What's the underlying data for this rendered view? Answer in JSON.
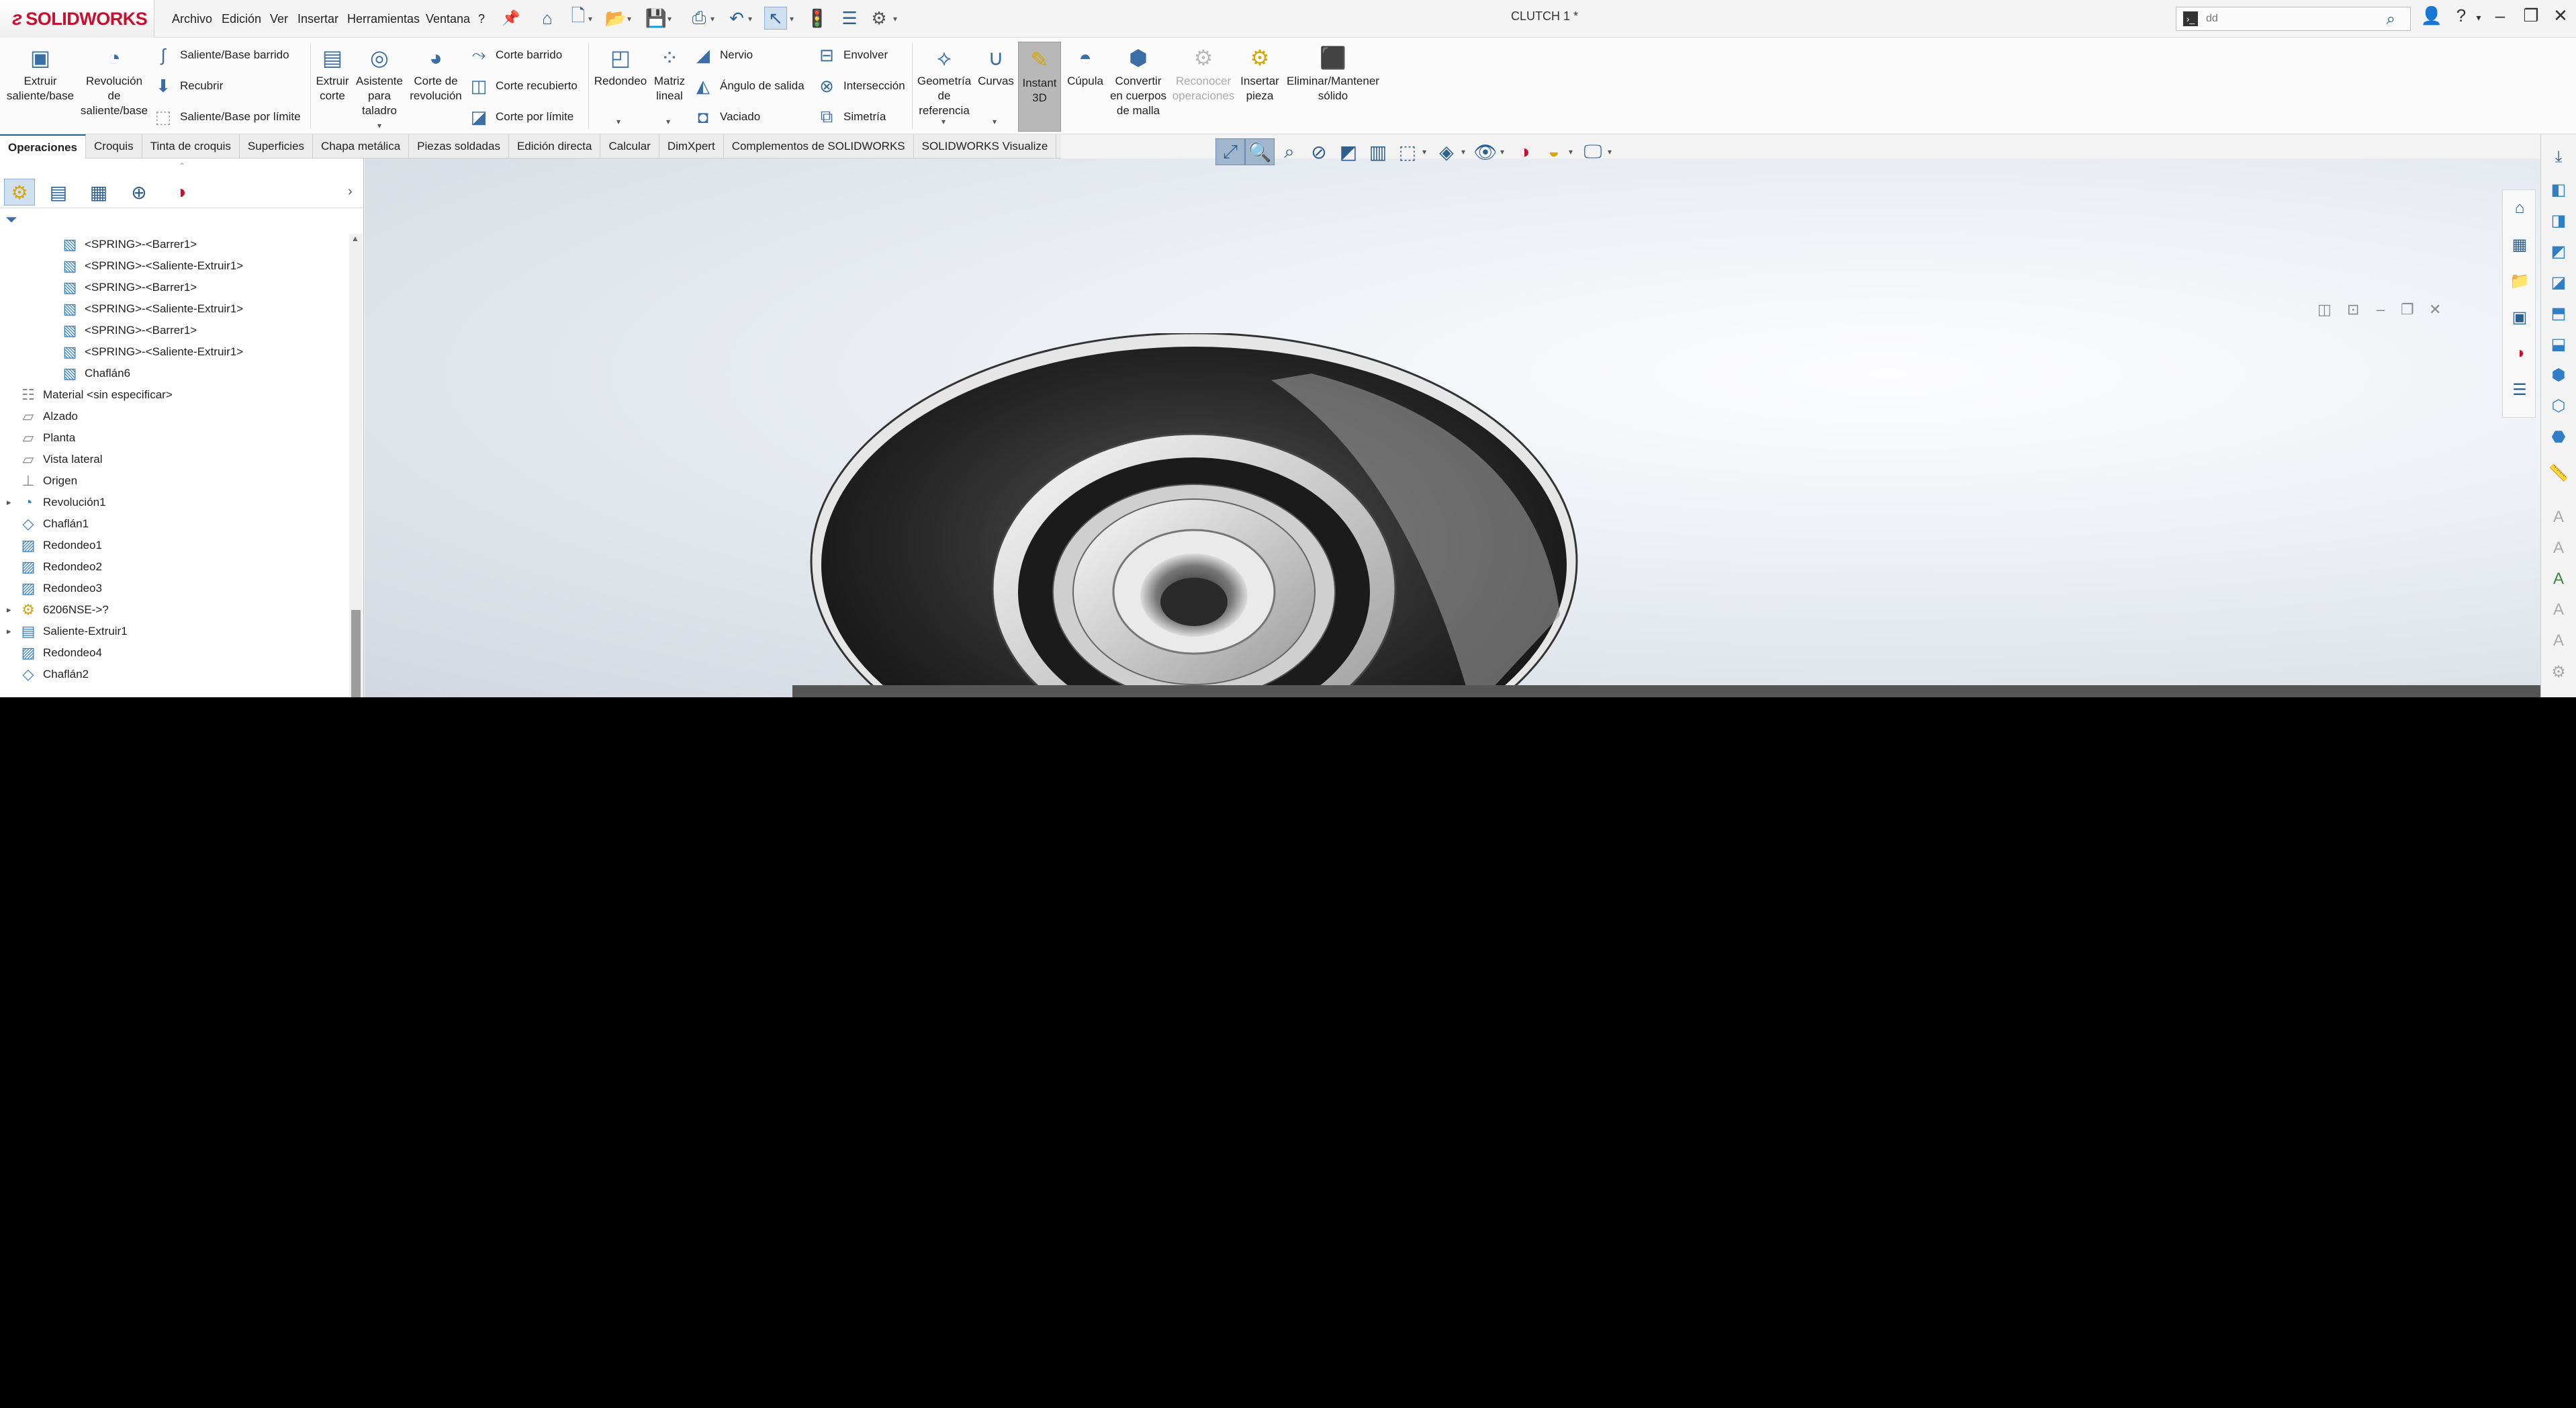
{
  "app": {
    "logo_text": "SOLIDWORKS",
    "document_title": "CLUTCH 1 *"
  },
  "menu": [
    "Archivo",
    "Edición",
    "Ver",
    "Insertar",
    "Herramientas",
    "Ventana",
    "?"
  ],
  "search": {
    "value": "dd",
    "icon": "search-icon"
  },
  "ribbon": {
    "extrude": "Extruir saliente/base",
    "revolve": "Revolución de saliente/base",
    "sweep": "Saliente/Base barrido",
    "loft": "Recubrir",
    "boundary": "Saliente/Base por límite",
    "extrude_cut": "Extruir corte",
    "hole_wizard": "Asistente para taladro",
    "revolve_cut": "Corte de revolución",
    "swept_cut": "Corte barrido",
    "lofted_cut": "Corte recubierto",
    "boundary_cut": "Corte por límite",
    "fillet": "Redondeo",
    "linear_pattern": "Matriz lineal",
    "rib": "Nervio",
    "draft": "Ángulo de salida",
    "shell": "Vaciado",
    "wrap": "Envolver",
    "intersect": "Intersección",
    "mirror": "Simetría",
    "ref_geometry": "Geometría de referencia",
    "curves": "Curvas",
    "instant3d": "Instant 3D",
    "dome": "Cúpula",
    "mesh_convert": "Convertir en cuerpos de malla",
    "feature_recognition": "Reconocer operaciones",
    "insert_part": "Insertar pieza",
    "delete_keep": "Eliminar/Mantener sólido"
  },
  "tabs": [
    "Operaciones",
    "Croquis",
    "Tinta de croquis",
    "Superficies",
    "Chapa metálica",
    "Piezas soldadas",
    "Edición directa",
    "Calcular",
    "DimXpert",
    "Complementos de SOLIDWORKS",
    "SOLIDWORKS Visualize"
  ],
  "tree": [
    {
      "label": "<SPRING>-<Barrer1>",
      "icon": "cube-icon",
      "indent": 2
    },
    {
      "label": "<SPRING>-<Saliente-Extruir1>",
      "icon": "cube-icon",
      "indent": 2
    },
    {
      "label": "<SPRING>-<Barrer1>",
      "icon": "cube-icon",
      "indent": 2
    },
    {
      "label": "<SPRING>-<Saliente-Extruir1>",
      "icon": "cube-icon",
      "indent": 2
    },
    {
      "label": "<SPRING>-<Barrer1>",
      "icon": "cube-icon",
      "indent": 2
    },
    {
      "label": "<SPRING>-<Saliente-Extruir1>",
      "icon": "cube-icon",
      "indent": 2
    },
    {
      "label": "Chaflán6",
      "icon": "cube-icon",
      "indent": 2
    },
    {
      "label": "Material <sin especificar>",
      "icon": "material-icon",
      "indent": 1
    },
    {
      "label": "Alzado",
      "icon": "plane-icon",
      "indent": 1
    },
    {
      "label": "Planta",
      "icon": "plane-icon",
      "indent": 1
    },
    {
      "label": "Vista lateral",
      "icon": "plane-icon",
      "indent": 1
    },
    {
      "label": "Origen",
      "icon": "origin-icon",
      "indent": 1
    },
    {
      "label": "Revolución1",
      "icon": "revolve-icon",
      "indent": 1,
      "expandable": true
    },
    {
      "label": "Chaflán1",
      "icon": "chamfer-icon",
      "indent": 1
    },
    {
      "label": "Redondeo1",
      "icon": "fillet-icon",
      "indent": 1
    },
    {
      "label": "Redondeo2",
      "icon": "fillet-icon",
      "indent": 1
    },
    {
      "label": "Redondeo3",
      "icon": "fillet-icon",
      "indent": 1
    },
    {
      "label": "6206NSE->?",
      "icon": "part-icon",
      "indent": 1,
      "expandable": true
    },
    {
      "label": "Saliente-Extruir1",
      "icon": "extrude-icon",
      "indent": 1,
      "expandable": true
    },
    {
      "label": "Redondeo4",
      "icon": "fillet-icon",
      "indent": 1
    },
    {
      "label": "Chaflán2",
      "icon": "chamfer-icon",
      "indent": 1
    }
  ],
  "colors": {
    "brand": "#c8102e",
    "accent": "#2f5f8f",
    "part_green": "#b9c24a"
  }
}
